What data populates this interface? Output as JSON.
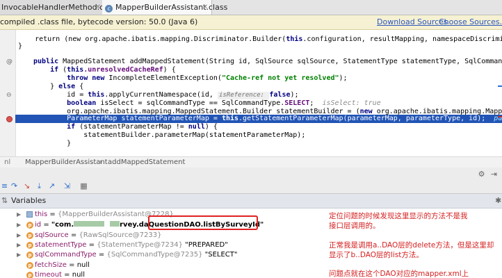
{
  "tabs": [
    {
      "label": "InvocableHandlerMethod.class",
      "active": false
    },
    {
      "label": "MapperBuilderAssistant.class",
      "active": true
    }
  ],
  "banner": {
    "text": "compiled .class file, bytecode version: 50.0 (Java 6)",
    "download_link": "Download Sources",
    "choose_link": "Choose Sources..."
  },
  "code": {
    "l1_a": "    return (new org.apache.ibatis.mapping.Discriminator.Builder(",
    "l1_this": "this",
    "l1_b": ".configuration, resultMapping, namespaceDiscriminatorMap",
    "l2": "}",
    "l3_kw": "public",
    "l3_rest": " MappedStatement addMappedStatement(String id, SqlSource sqlSource, StatementType statementType, SqlCommandType sqlC",
    "l4_kw": "    if",
    "l4_a": " (",
    "l4_this": "this",
    "l4_fld": ".unresolvedCacheRef",
    "l4_b": ") {",
    "l5_kw1": "        throw new",
    "l5_a": " IncompleteElementException(",
    "l5_str": "\"Cache-ref not yet resolved\"",
    "l5_b": ");",
    "l6_a": "    } ",
    "l6_kw": "else",
    "l6_b": " {",
    "l7_a": "        id = ",
    "l7_this": "this",
    "l7_b": ".applyCurrentNamespace(id, ",
    "l7_hint": "isReference: ",
    "l7_kw": "false",
    "l7_c": ");",
    "l8_kw": "        boolean",
    "l8_a": " isSelect = sqlCommandType == SqlCommandType.",
    "l8_fld": "SELECT",
    "l8_b": ";  ",
    "l8_cmt": "isSelect: true",
    "l9_a": "        org.apache.ibatis.mapping.MappedStatement.Builder statementBuilder = (",
    "l9_kw": "new",
    "l9_b": " org.apache.ibatis.mapping.MappedStatement.",
    "l10_a": "        ParameterMap statementParameterMap = ",
    "l10_this": "this",
    "l10_b": ".getStatementParameterMap(parameterMap, parameterType, id);  ",
    "l10_c": "parameterMap: ",
    "l11_kw": "        if",
    "l11_a": " (statementParameterMap != ",
    "l11_null": "null",
    "l11_b": ") {",
    "l12": "            statementBuilder.parameterMap(statementParameterMap);",
    "l13": "        }"
  },
  "breadcrumb": {
    "class_name": "MapperBuilderAssistant",
    "separator": "›",
    "method": "addMappedStatement"
  },
  "variables": {
    "header": "Variables",
    "rows": [
      {
        "name": "this",
        "eq": " = ",
        "type": "{MapperBuilderAssistant@7228}",
        "value": ""
      },
      {
        "name": "id",
        "eq": " = ",
        "type": "",
        "value": "\"com.",
        "value2": "rvey.da",
        "value3": "QuestionDAO.listBySurveyId\""
      },
      {
        "name": "sqlSource",
        "eq": " = ",
        "type": "{RawSqlSource@7233}",
        "value": ""
      },
      {
        "name": "statementType",
        "eq": " = ",
        "type": "{StatementType@7234} ",
        "value": "\"PREPARED\""
      },
      {
        "name": "sqlCommandType",
        "eq": " = ",
        "type": "{SqlCommandType@7235} ",
        "value": "\"SELECT\""
      },
      {
        "name": "fetchSize",
        "eq": " = ",
        "type": "",
        "value": "null"
      },
      {
        "name": "timeout",
        "eq": " = ",
        "type": "",
        "value": "null"
      }
    ]
  },
  "notes": [
    "定位问题的时候发现这里显示的方法不是我",
    "接口层调用的。",
    "正常我是调用a..DAO层的delete方法，但是这里却",
    "显示了b..DAO层的list方法。",
    "问题点就在这个DAO对应的mapper.xml上"
  ],
  "colors": {
    "highlight": "#2154b5",
    "annotation": "#d42020",
    "banner_bg": "#f5f1d2"
  }
}
